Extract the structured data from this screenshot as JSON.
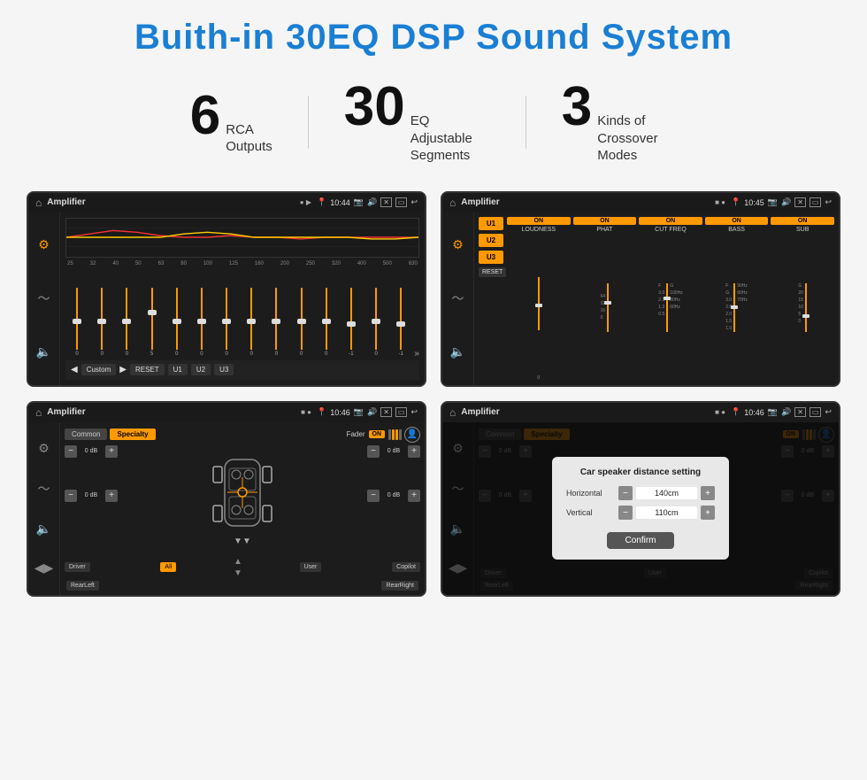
{
  "header": {
    "title": "Buith-in 30EQ DSP Sound System"
  },
  "stats": [
    {
      "number": "6",
      "desc": "RCA\nOutputs"
    },
    {
      "number": "30",
      "desc": "EQ Adjustable\nSegments"
    },
    {
      "number": "3",
      "desc": "Kinds of\nCrossover Modes"
    }
  ],
  "screens": {
    "eq_screen": {
      "status_title": "Amplifier",
      "time": "10:44",
      "freq_labels": [
        "25",
        "32",
        "40",
        "50",
        "63",
        "80",
        "100",
        "125",
        "160",
        "200",
        "250",
        "320",
        "400",
        "500",
        "630"
      ],
      "slider_values": [
        "0",
        "0",
        "0",
        "5",
        "0",
        "0",
        "0",
        "0",
        "0",
        "0",
        "0",
        "-1",
        "0",
        "-1"
      ],
      "buttons": [
        "Custom",
        "RESET",
        "U1",
        "U2",
        "U3"
      ]
    },
    "crossover_screen": {
      "status_title": "Amplifier",
      "time": "10:45",
      "u_buttons": [
        "U1",
        "U2",
        "U3"
      ],
      "channels": [
        {
          "label": "LOUDNESS",
          "on": true
        },
        {
          "label": "PHAT",
          "on": true
        },
        {
          "label": "CUT FREQ",
          "on": true
        },
        {
          "label": "BASS",
          "on": true
        },
        {
          "label": "SUB",
          "on": true
        }
      ],
      "reset_label": "RESET"
    },
    "speaker_screen": {
      "status_title": "Amplifier",
      "time": "10:46",
      "tabs": [
        "Common",
        "Specialty"
      ],
      "fader_label": "Fader",
      "on_label": "ON",
      "left_db_values": [
        "0 dB",
        "0 dB"
      ],
      "right_db_values": [
        "0 dB",
        "0 dB"
      ],
      "bottom_buttons": [
        "Driver",
        "All",
        "User",
        "Copilot",
        "RearLeft",
        "RearRight"
      ]
    },
    "distance_screen": {
      "status_title": "Amplifier",
      "time": "10:46",
      "tabs": [
        "Common",
        "Specialty"
      ],
      "on_label": "ON",
      "dialog": {
        "title": "Car speaker distance setting",
        "rows": [
          {
            "label": "Horizontal",
            "value": "140cm"
          },
          {
            "label": "Vertical",
            "value": "110cm"
          }
        ],
        "confirm_label": "Confirm"
      },
      "right_db_values": [
        "0 dB",
        "0 dB"
      ],
      "bottom_buttons": [
        "Driver",
        "User",
        "Copilot",
        "RearLeft",
        "RearRight"
      ]
    }
  }
}
